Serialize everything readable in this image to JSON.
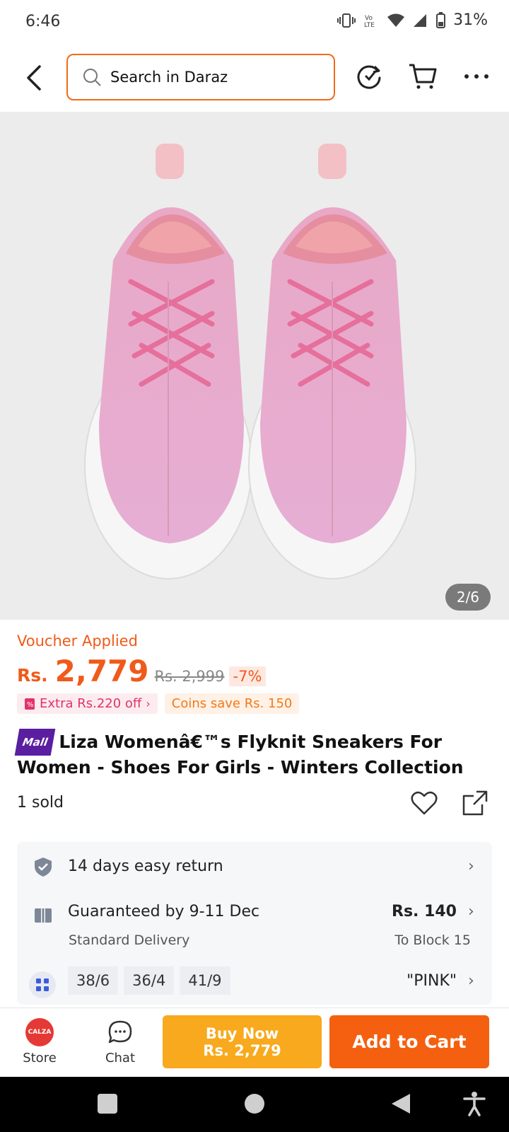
{
  "status_bar": {
    "time": "6:46",
    "battery": "31%"
  },
  "header": {
    "search_placeholder": "Search in Daraz"
  },
  "gallery": {
    "counter": "2/6"
  },
  "product": {
    "voucher": "Voucher Applied",
    "currency": "Rs.",
    "price": "2,779",
    "old_price": "Rs. 2,999",
    "discount": "-7%",
    "promo_extra": "Extra Rs.220 off",
    "promo_coins": "Coins save Rs. 150",
    "mall_badge": "Mall",
    "title": "Liza Womenâ€™s Flyknit Sneakers For Women - Shoes For Girls - Winters Collection",
    "sold": "1 sold"
  },
  "info": {
    "return": "14 days easy return",
    "delivery": "Guaranteed by 9-11 Dec",
    "delivery_type": "Standard Delivery",
    "delivery_price": "Rs. 140",
    "delivery_to": "To Block 15",
    "variants": [
      "38/6",
      "36/4",
      "41/9"
    ],
    "color": "\"PINK\""
  },
  "bottom": {
    "store_logo": "CALZA",
    "store": "Store",
    "chat": "Chat",
    "buy_now": "Buy Now",
    "buy_price": "Rs. 2,779",
    "add_to_cart": "Add to Cart"
  },
  "colors": {
    "accent": "#f4600f",
    "buy": "#f8a91d",
    "mall": "#5a1ea0"
  }
}
